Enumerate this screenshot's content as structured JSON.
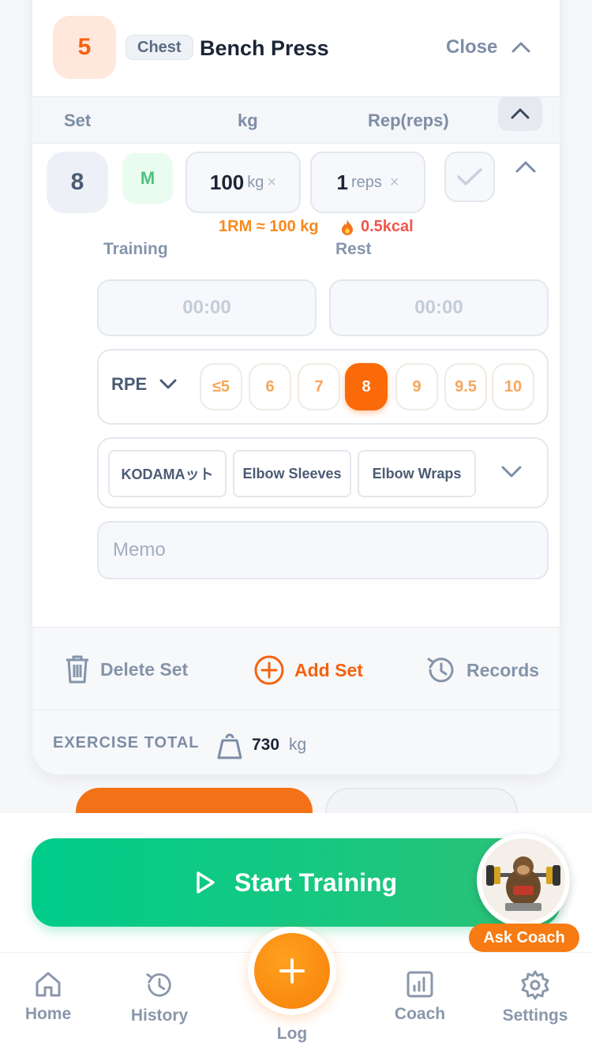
{
  "exercise": {
    "number": "5",
    "category": "Chest",
    "name": "Bench Press",
    "close_label": "Close"
  },
  "columns": {
    "set": "Set",
    "kg": "kg",
    "reps": "Rep(reps)"
  },
  "set_row": {
    "number": "8",
    "type": "M",
    "weight_value": "100",
    "weight_unit": "kg",
    "reps_value": "1",
    "reps_unit": "reps",
    "one_rm": "1RM ≈ 100 kg",
    "kcal": "0.5kcal"
  },
  "timers": {
    "training_label": "Training",
    "training_value": "00:00",
    "rest_label": "Rest",
    "rest_value": "00:00"
  },
  "rpe": {
    "label": "RPE",
    "options": [
      "≤5",
      "6",
      "7",
      "8",
      "9",
      "9.5",
      "10"
    ],
    "selected": "8"
  },
  "gear": [
    "KODAMAット",
    "Elbow Sleeves",
    "Elbow Wraps"
  ],
  "memo_placeholder": "Memo",
  "actions": {
    "delete": "Delete Set",
    "add": "Add Set",
    "records": "Records"
  },
  "total": {
    "label": "EXERCISE TOTAL",
    "value": "730",
    "unit": "kg"
  },
  "start_training": "Start Training",
  "ask_coach": "Ask Coach",
  "nav": {
    "home": "Home",
    "history": "History",
    "log": "Log",
    "coach": "Coach",
    "settings": "Settings"
  },
  "colors": {
    "accent_orange": "#fb6a09",
    "start_green": "#00cc8a",
    "set_type_green": "#4cc47a",
    "kcal_red": "#f0564a"
  },
  "icons": [
    "chevron-up-icon",
    "check-icon",
    "flame-icon",
    "chevron-down-icon",
    "trash-icon",
    "plus-circle-icon",
    "history-icon",
    "weight-icon",
    "play-icon",
    "home-icon",
    "chart-icon",
    "gear-icon",
    "plus-icon"
  ]
}
